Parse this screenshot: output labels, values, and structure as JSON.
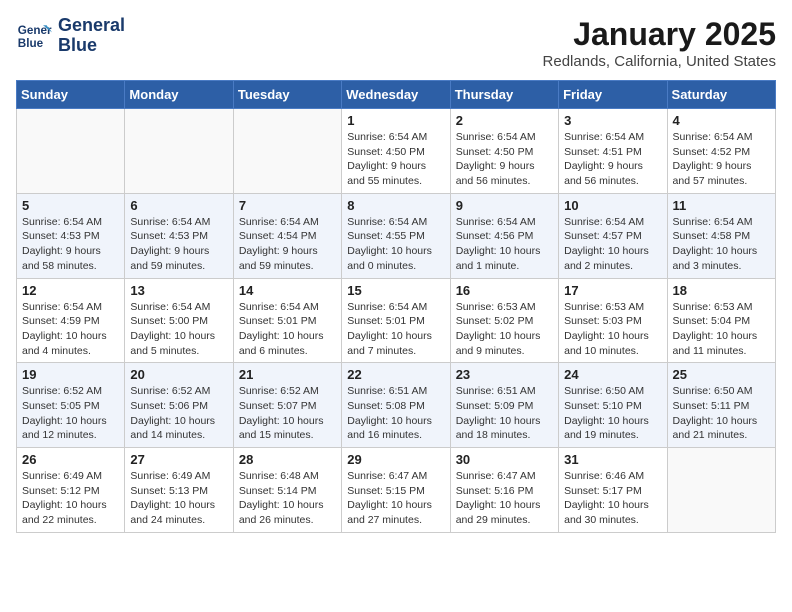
{
  "header": {
    "logo_line1": "General",
    "logo_line2": "Blue",
    "title": "January 2025",
    "subtitle": "Redlands, California, United States"
  },
  "days_of_week": [
    "Sunday",
    "Monday",
    "Tuesday",
    "Wednesday",
    "Thursday",
    "Friday",
    "Saturday"
  ],
  "weeks": [
    [
      {
        "day": "",
        "info": ""
      },
      {
        "day": "",
        "info": ""
      },
      {
        "day": "",
        "info": ""
      },
      {
        "day": "1",
        "info": "Sunrise: 6:54 AM\nSunset: 4:50 PM\nDaylight: 9 hours and 55 minutes."
      },
      {
        "day": "2",
        "info": "Sunrise: 6:54 AM\nSunset: 4:50 PM\nDaylight: 9 hours and 56 minutes."
      },
      {
        "day": "3",
        "info": "Sunrise: 6:54 AM\nSunset: 4:51 PM\nDaylight: 9 hours and 56 minutes."
      },
      {
        "day": "4",
        "info": "Sunrise: 6:54 AM\nSunset: 4:52 PM\nDaylight: 9 hours and 57 minutes."
      }
    ],
    [
      {
        "day": "5",
        "info": "Sunrise: 6:54 AM\nSunset: 4:53 PM\nDaylight: 9 hours and 58 minutes."
      },
      {
        "day": "6",
        "info": "Sunrise: 6:54 AM\nSunset: 4:53 PM\nDaylight: 9 hours and 59 minutes."
      },
      {
        "day": "7",
        "info": "Sunrise: 6:54 AM\nSunset: 4:54 PM\nDaylight: 9 hours and 59 minutes."
      },
      {
        "day": "8",
        "info": "Sunrise: 6:54 AM\nSunset: 4:55 PM\nDaylight: 10 hours and 0 minutes."
      },
      {
        "day": "9",
        "info": "Sunrise: 6:54 AM\nSunset: 4:56 PM\nDaylight: 10 hours and 1 minute."
      },
      {
        "day": "10",
        "info": "Sunrise: 6:54 AM\nSunset: 4:57 PM\nDaylight: 10 hours and 2 minutes."
      },
      {
        "day": "11",
        "info": "Sunrise: 6:54 AM\nSunset: 4:58 PM\nDaylight: 10 hours and 3 minutes."
      }
    ],
    [
      {
        "day": "12",
        "info": "Sunrise: 6:54 AM\nSunset: 4:59 PM\nDaylight: 10 hours and 4 minutes."
      },
      {
        "day": "13",
        "info": "Sunrise: 6:54 AM\nSunset: 5:00 PM\nDaylight: 10 hours and 5 minutes."
      },
      {
        "day": "14",
        "info": "Sunrise: 6:54 AM\nSunset: 5:01 PM\nDaylight: 10 hours and 6 minutes."
      },
      {
        "day": "15",
        "info": "Sunrise: 6:54 AM\nSunset: 5:01 PM\nDaylight: 10 hours and 7 minutes."
      },
      {
        "day": "16",
        "info": "Sunrise: 6:53 AM\nSunset: 5:02 PM\nDaylight: 10 hours and 9 minutes."
      },
      {
        "day": "17",
        "info": "Sunrise: 6:53 AM\nSunset: 5:03 PM\nDaylight: 10 hours and 10 minutes."
      },
      {
        "day": "18",
        "info": "Sunrise: 6:53 AM\nSunset: 5:04 PM\nDaylight: 10 hours and 11 minutes."
      }
    ],
    [
      {
        "day": "19",
        "info": "Sunrise: 6:52 AM\nSunset: 5:05 PM\nDaylight: 10 hours and 12 minutes."
      },
      {
        "day": "20",
        "info": "Sunrise: 6:52 AM\nSunset: 5:06 PM\nDaylight: 10 hours and 14 minutes."
      },
      {
        "day": "21",
        "info": "Sunrise: 6:52 AM\nSunset: 5:07 PM\nDaylight: 10 hours and 15 minutes."
      },
      {
        "day": "22",
        "info": "Sunrise: 6:51 AM\nSunset: 5:08 PM\nDaylight: 10 hours and 16 minutes."
      },
      {
        "day": "23",
        "info": "Sunrise: 6:51 AM\nSunset: 5:09 PM\nDaylight: 10 hours and 18 minutes."
      },
      {
        "day": "24",
        "info": "Sunrise: 6:50 AM\nSunset: 5:10 PM\nDaylight: 10 hours and 19 minutes."
      },
      {
        "day": "25",
        "info": "Sunrise: 6:50 AM\nSunset: 5:11 PM\nDaylight: 10 hours and 21 minutes."
      }
    ],
    [
      {
        "day": "26",
        "info": "Sunrise: 6:49 AM\nSunset: 5:12 PM\nDaylight: 10 hours and 22 minutes."
      },
      {
        "day": "27",
        "info": "Sunrise: 6:49 AM\nSunset: 5:13 PM\nDaylight: 10 hours and 24 minutes."
      },
      {
        "day": "28",
        "info": "Sunrise: 6:48 AM\nSunset: 5:14 PM\nDaylight: 10 hours and 26 minutes."
      },
      {
        "day": "29",
        "info": "Sunrise: 6:47 AM\nSunset: 5:15 PM\nDaylight: 10 hours and 27 minutes."
      },
      {
        "day": "30",
        "info": "Sunrise: 6:47 AM\nSunset: 5:16 PM\nDaylight: 10 hours and 29 minutes."
      },
      {
        "day": "31",
        "info": "Sunrise: 6:46 AM\nSunset: 5:17 PM\nDaylight: 10 hours and 30 minutes."
      },
      {
        "day": "",
        "info": ""
      }
    ]
  ]
}
